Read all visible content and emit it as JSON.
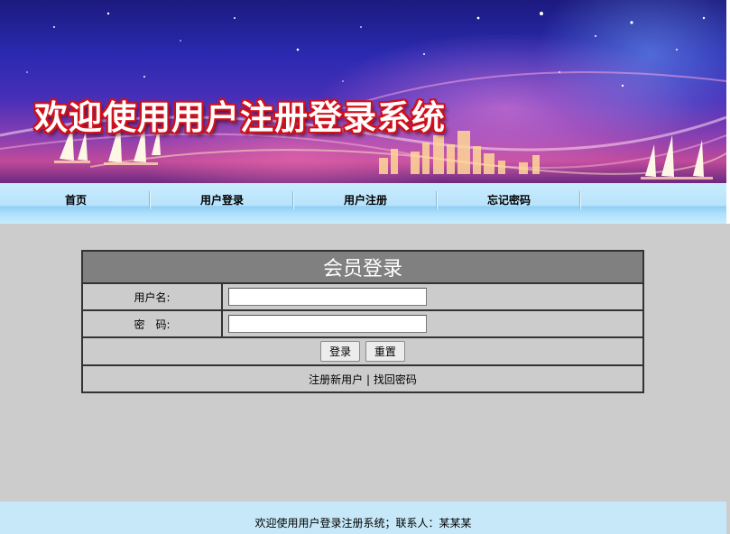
{
  "banner": {
    "title": "欢迎使用用户注册登录系统"
  },
  "nav": {
    "items": [
      {
        "label": "首页"
      },
      {
        "label": "用户登录"
      },
      {
        "label": "用户注册"
      },
      {
        "label": "忘记密码"
      }
    ]
  },
  "login": {
    "title": "会员登录",
    "username_label": "用户名:",
    "username_value": "",
    "password_label": "密　码:",
    "password_value": "",
    "submit_label": "登录",
    "reset_label": "重置",
    "register_link": "注册新用户",
    "link_separator": " | ",
    "recover_link": "找回密码"
  },
  "footer": {
    "text": "欢迎使用用户登录注册系统；联系人：某某某"
  },
  "colors": {
    "page_bg": "#cccccc",
    "nav_bg": "#b8e3fb",
    "table_header_bg": "#808080",
    "footer_bg": "#c6e8f8",
    "title_outline": "#d0101a"
  }
}
